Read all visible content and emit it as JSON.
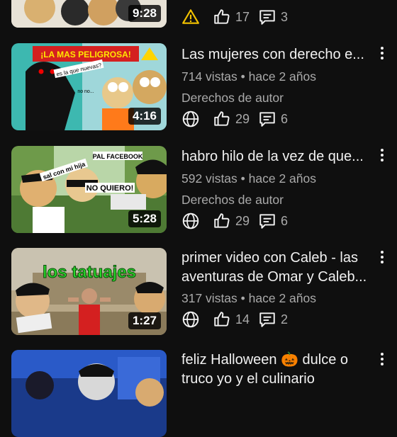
{
  "videos": [
    {
      "title": "",
      "duration": "9:28",
      "views": "",
      "rights": "",
      "status_icon": "warning-icon",
      "likes": "17",
      "comments": "3"
    },
    {
      "title": "Las mujeres con derecho e...",
      "duration": "4:16",
      "thumb_text": [
        "¡LA MAS PELIGROSA!",
        "es la que nuevas?",
        "no no..."
      ],
      "views": "714 vistas • hace 2 años",
      "rights": "Derechos de autor",
      "status_icon": "globe-icon",
      "likes": "29",
      "comments": "6"
    },
    {
      "title": "habro hilo de la vez de que...",
      "duration": "5:28",
      "thumb_text": [
        "PAL FACEBOOK",
        "sal con mi hija",
        "NO QUIERO!"
      ],
      "views": "592 vistas • hace 2 años",
      "rights": "Derechos de autor",
      "status_icon": "globe-icon",
      "likes": "29",
      "comments": "6"
    },
    {
      "title": "primer video con Caleb - las aventuras de Omar y Caleb...",
      "duration": "1:27",
      "thumb_text": [
        "los tatuajes"
      ],
      "views": "317 vistas • hace 2 años",
      "status_icon": "globe-icon",
      "likes": "14",
      "comments": "2"
    },
    {
      "title": "feliz Halloween 🎃 dulce o truco yo y el culinario",
      "views": "",
      "status_icon": "globe-icon"
    }
  ],
  "colors": {
    "background": "#0f0f0f",
    "text": "#f1f1f1",
    "secondary": "#aaaaaa",
    "warning": "#f2c200"
  }
}
